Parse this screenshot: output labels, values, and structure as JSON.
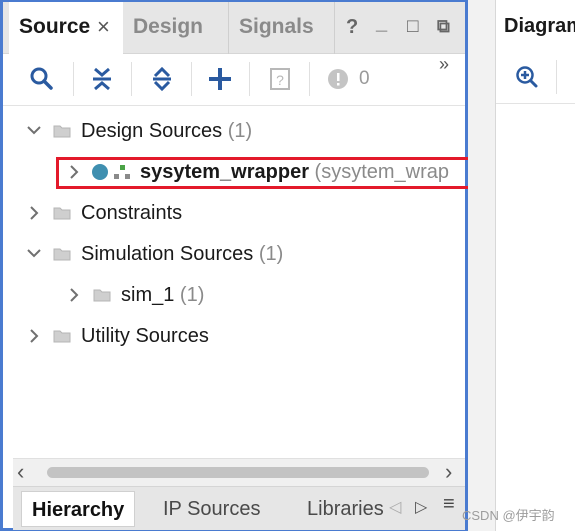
{
  "left_panel": {
    "tabs": [
      {
        "label": "Source",
        "active": true
      },
      {
        "label": "Design",
        "active": false
      },
      {
        "label": "Signals",
        "active": false
      }
    ],
    "window_controls": {
      "help": "?",
      "minimize": "_",
      "maximize": "□",
      "float": "⧉"
    },
    "toolbar": {
      "icons": [
        "search-icon",
        "collapse-all-icon",
        "expand-all-icon",
        "add-icon",
        "properties-icon",
        "messages-icon"
      ],
      "message_count": "0",
      "more": "»"
    },
    "tree": {
      "items": [
        {
          "label": "Design Sources",
          "count": "(1)",
          "expanded": true
        },
        {
          "label": "sysytem_wrapper",
          "sub": "(sysytem_wrap",
          "expanded": false
        },
        {
          "label": "Constraints",
          "count": "",
          "expanded": false
        },
        {
          "label": "Simulation Sources",
          "count": "(1)",
          "expanded": true
        },
        {
          "label": "sim_1",
          "count": "(1)",
          "expanded": false
        },
        {
          "label": "Utility Sources",
          "count": "",
          "expanded": false
        }
      ]
    },
    "scrollbar": {
      "left_arrow": "‹",
      "right_arrow": "›"
    },
    "bottom_tabs": [
      {
        "label": "Hierarchy",
        "active": true
      },
      {
        "label": "IP Sources",
        "active": false
      },
      {
        "label": "Libraries",
        "active": false
      }
    ],
    "bottom_nav": {
      "prev": "◁",
      "next": "▷",
      "menu": "≡"
    }
  },
  "right_panel": {
    "tab_label": "Diagram",
    "toolbar_icons": [
      "zoom-in-icon"
    ]
  },
  "watermark": "CSDN @伊宇韵",
  "colors": {
    "accent_border": "#4a7bd0",
    "highlight_box": "#e3192a",
    "tab_bg": "#e6e6e6",
    "status_dot": "#3f8fb0",
    "hierarchy_icon": "#4aa346"
  }
}
